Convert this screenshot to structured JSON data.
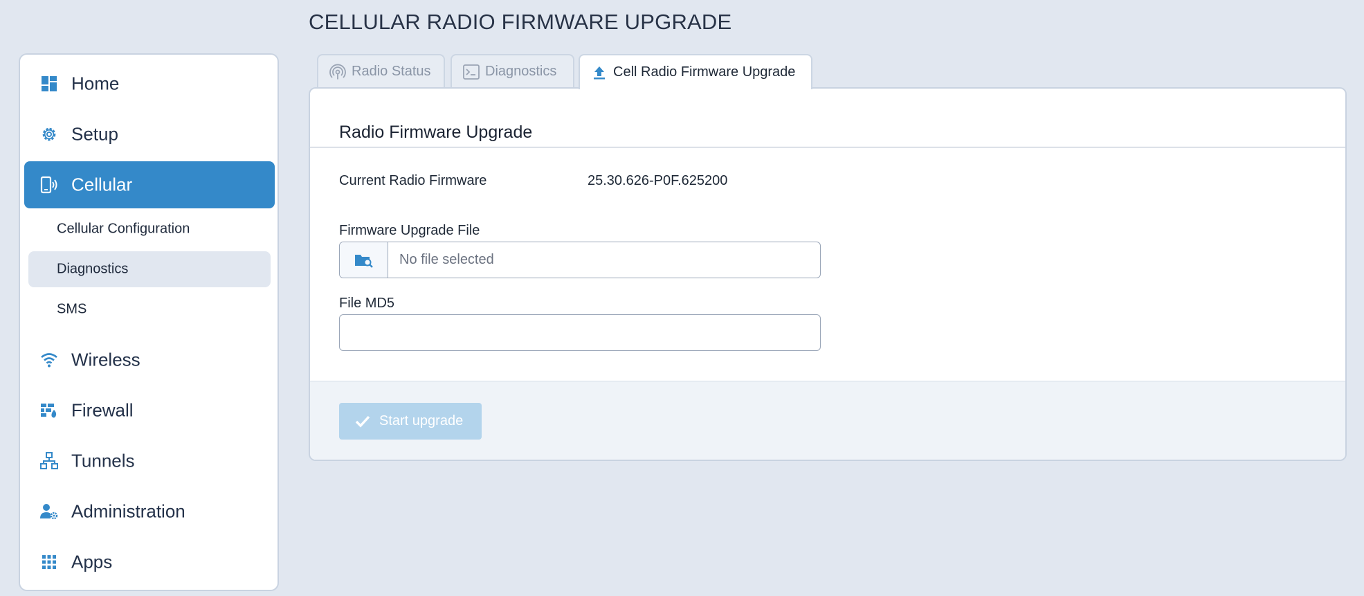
{
  "page": {
    "title": "CELLULAR RADIO FIRMWARE UPGRADE"
  },
  "sidebar": {
    "items": [
      {
        "label": "Home",
        "icon": "dashboard-icon",
        "active": false
      },
      {
        "label": "Setup",
        "icon": "gear-icon",
        "active": false
      },
      {
        "label": "Cellular",
        "icon": "cellular-device-icon",
        "active": true
      },
      {
        "label": "Wireless",
        "icon": "wifi-icon",
        "active": false
      },
      {
        "label": "Firewall",
        "icon": "firewall-icon",
        "active": false
      },
      {
        "label": "Tunnels",
        "icon": "network-icon",
        "active": false
      },
      {
        "label": "Administration",
        "icon": "user-gear-icon",
        "active": false
      },
      {
        "label": "Apps",
        "icon": "apps-grid-icon",
        "active": false
      }
    ],
    "subitems": [
      {
        "label": "Cellular Configuration",
        "selected": false
      },
      {
        "label": "Diagnostics",
        "selected": true
      },
      {
        "label": "SMS",
        "selected": false
      }
    ]
  },
  "tabs": [
    {
      "label": "Radio Status",
      "icon": "radio-signal-icon",
      "active": false
    },
    {
      "label": "Diagnostics",
      "icon": "terminal-icon",
      "active": false
    },
    {
      "label": "Cell Radio Firmware Upgrade",
      "icon": "upload-icon",
      "active": true
    }
  ],
  "panel": {
    "heading": "Radio Firmware Upgrade",
    "current_firmware_label": "Current Radio Firmware",
    "current_firmware_value": "25.30.626-P0F.625200",
    "upgrade_file_label": "Firmware Upgrade File",
    "upgrade_file_placeholder": "No file selected",
    "md5_label": "File MD5",
    "md5_value": "",
    "start_button_label": "Start upgrade"
  },
  "colors": {
    "accent": "#3489c9",
    "background": "#e1e7f0",
    "disabled_button": "#b3d4ec"
  }
}
